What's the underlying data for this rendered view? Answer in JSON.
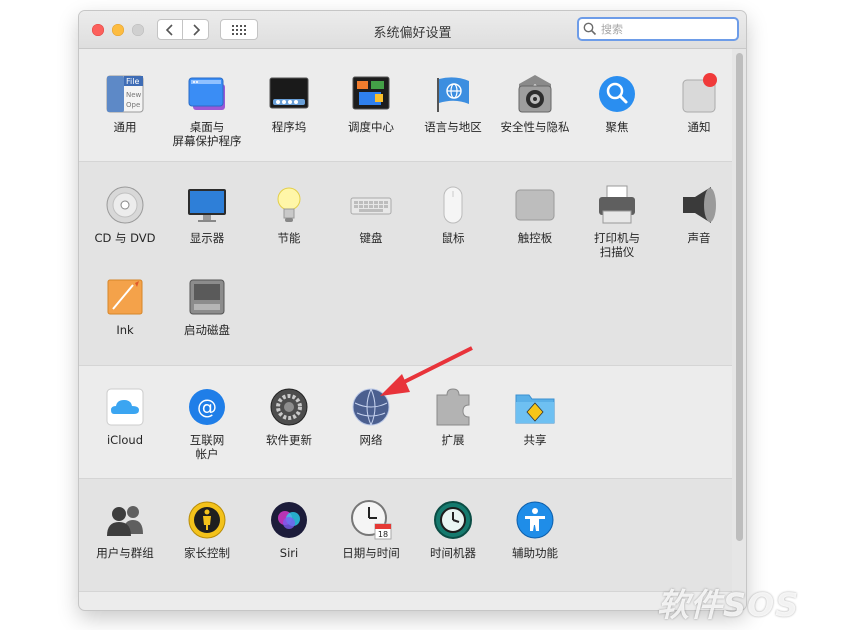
{
  "window": {
    "title": "系统偏好设置"
  },
  "search": {
    "placeholder": "搜索"
  },
  "sections": [
    {
      "panes": [
        {
          "label": "通用",
          "icon": "general-icon"
        },
        {
          "label": "桌面与\n屏幕保护程序",
          "icon": "desktop-screensaver-icon"
        },
        {
          "label": "程序坞",
          "icon": "dock-icon"
        },
        {
          "label": "调度中心",
          "icon": "mission-control-icon"
        },
        {
          "label": "语言与地区",
          "icon": "language-region-icon"
        },
        {
          "label": "安全性与隐私",
          "icon": "security-privacy-icon"
        },
        {
          "label": "聚焦",
          "icon": "spotlight-icon"
        },
        {
          "label": "通知",
          "icon": "notifications-icon"
        }
      ]
    },
    {
      "panes": [
        {
          "label": "CD 与 DVD",
          "icon": "cd-dvd-icon"
        },
        {
          "label": "显示器",
          "icon": "displays-icon"
        },
        {
          "label": "节能",
          "icon": "energy-saver-icon"
        },
        {
          "label": "键盘",
          "icon": "keyboard-icon"
        },
        {
          "label": "鼠标",
          "icon": "mouse-icon"
        },
        {
          "label": "触控板",
          "icon": "trackpad-icon"
        },
        {
          "label": "打印机与\n扫描仪",
          "icon": "printers-scanners-icon"
        },
        {
          "label": "声音",
          "icon": "sound-icon"
        },
        {
          "label": "Ink",
          "icon": "ink-icon"
        },
        {
          "label": "启动磁盘",
          "icon": "startup-disk-icon"
        }
      ]
    },
    {
      "panes": [
        {
          "label": "iCloud",
          "icon": "icloud-icon"
        },
        {
          "label": "互联网\n帐户",
          "icon": "internet-accounts-icon"
        },
        {
          "label": "软件更新",
          "icon": "software-update-icon"
        },
        {
          "label": "网络",
          "icon": "network-icon"
        },
        {
          "label": "扩展",
          "icon": "extensions-icon"
        },
        {
          "label": "共享",
          "icon": "sharing-icon"
        }
      ]
    },
    {
      "panes": [
        {
          "label": "用户与群组",
          "icon": "users-groups-icon"
        },
        {
          "label": "家长控制",
          "icon": "parental-controls-icon"
        },
        {
          "label": "Siri",
          "icon": "siri-icon"
        },
        {
          "label": "日期与时间",
          "icon": "date-time-icon"
        },
        {
          "label": "时间机器",
          "icon": "time-machine-icon"
        },
        {
          "label": "辅助功能",
          "icon": "accessibility-icon"
        }
      ]
    }
  ],
  "watermark": "软件SOS",
  "colors": {
    "accent": "#6d9ce8",
    "annotation_arrow": "#e8333a"
  }
}
